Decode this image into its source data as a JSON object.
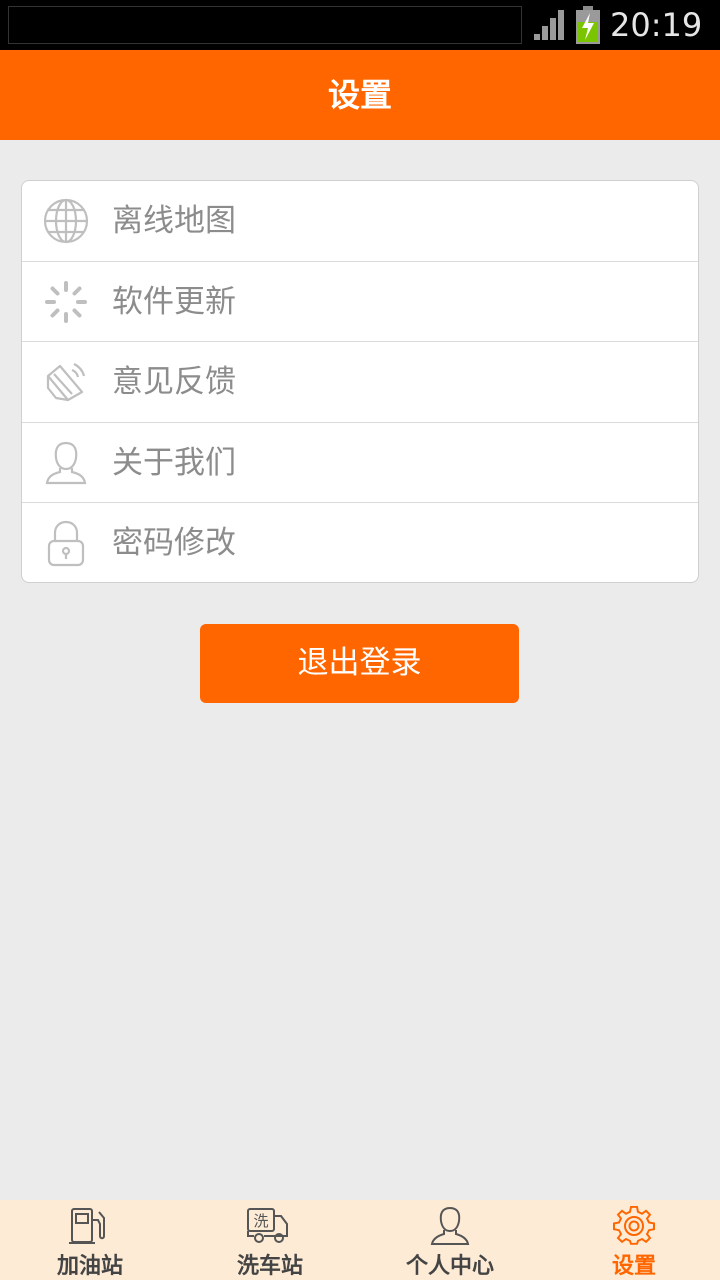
{
  "status_bar": {
    "time": "20:19"
  },
  "header": {
    "title": "设置"
  },
  "settings": {
    "items": [
      {
        "label": "离线地图",
        "icon": "globe-icon"
      },
      {
        "label": "软件更新",
        "icon": "loading-spinner-icon"
      },
      {
        "label": "意见反馈",
        "icon": "feedback-megaphone-icon"
      },
      {
        "label": "关于我们",
        "icon": "person-icon"
      },
      {
        "label": "密码修改",
        "icon": "lock-icon"
      }
    ]
  },
  "logout": {
    "label": "退出登录"
  },
  "bottom_nav": {
    "items": [
      {
        "label": "加油站",
        "icon": "fuel-pump-icon",
        "active": false
      },
      {
        "label": "洗车站",
        "icon": "car-wash-truck-icon",
        "active": false,
        "icon_text": "洗"
      },
      {
        "label": "个人中心",
        "icon": "user-profile-icon",
        "active": false
      },
      {
        "label": "设置",
        "icon": "gear-icon",
        "active": true
      }
    ]
  },
  "colors": {
    "accent": "#ff6600",
    "background": "#ebebeb",
    "nav_background": "#fdebd6",
    "icon_gray": "#bfbfbf"
  }
}
